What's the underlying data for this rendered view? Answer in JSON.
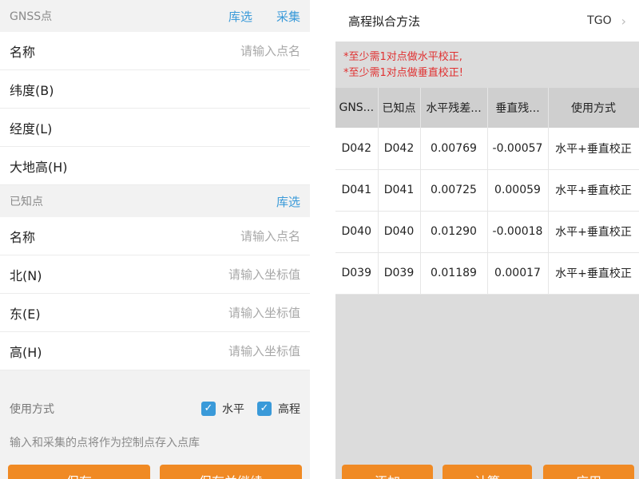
{
  "left": {
    "gnss_section": {
      "title": "GNSS点",
      "pick_label": "库选",
      "collect_label": "采集"
    },
    "gnss_fields": [
      {
        "label": "名称",
        "placeholder": "请输入点名"
      },
      {
        "label": "纬度(B)",
        "placeholder": ""
      },
      {
        "label": "经度(L)",
        "placeholder": ""
      },
      {
        "label": "大地高(H)",
        "placeholder": ""
      }
    ],
    "known_section": {
      "title": "已知点",
      "pick_label": "库选"
    },
    "known_fields": [
      {
        "label": "名称",
        "placeholder": "请输入点名"
      },
      {
        "label": "北(N)",
        "placeholder": "请输入坐标值"
      },
      {
        "label": "东(E)",
        "placeholder": "请输入坐标值"
      },
      {
        "label": "高(H)",
        "placeholder": "请输入坐标值"
      }
    ],
    "usage": {
      "label": "使用方式",
      "horizontal": "水平",
      "elevation": "高程",
      "horizontal_checked": true,
      "elevation_checked": true
    },
    "hint": "输入和采集的点将作为控制点存入点库",
    "buttons": {
      "save": "保存",
      "save_continue": "保存并继续"
    }
  },
  "right": {
    "header": {
      "title": "高程拟合方法",
      "value": "TGO"
    },
    "warnings": [
      "*至少需1对点做水平校正,",
      "*至少需1对点做垂直校正!"
    ],
    "table": {
      "headers": [
        "GNS...",
        "已知点",
        "水平残差...",
        "垂直残...",
        "使用方式"
      ],
      "rows": [
        [
          "D042",
          "D042",
          "0.00769",
          "-0.00057",
          "水平+垂直校正"
        ],
        [
          "D041",
          "D041",
          "0.00725",
          "0.00059",
          "水平+垂直校正"
        ],
        [
          "D040",
          "D040",
          "0.01290",
          "-0.00018",
          "水平+垂直校正"
        ],
        [
          "D039",
          "D039",
          "0.01189",
          "0.00017",
          "水平+垂直校正"
        ]
      ]
    },
    "buttons": {
      "add": "添加",
      "compute": "计算",
      "apply": "应用"
    }
  },
  "colors": {
    "accent": "#3a9ad9",
    "button": "#f08a24",
    "warning": "#e03030"
  }
}
